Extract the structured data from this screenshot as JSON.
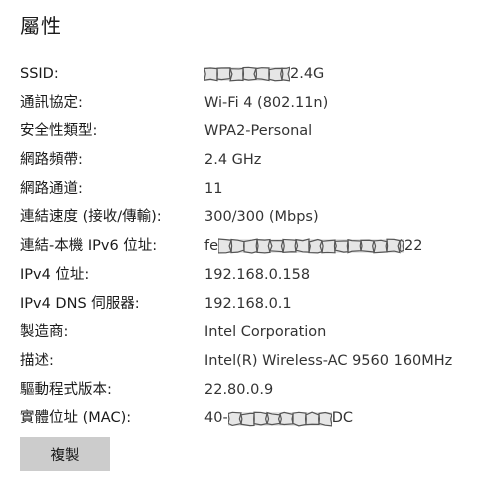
{
  "title": "屬性",
  "properties": [
    {
      "label": "SSID:",
      "value_prefix": "",
      "value_suffix": "2.4G",
      "redacted": true
    },
    {
      "label": "通訊協定:",
      "value": "Wi-Fi 4 (802.11n)"
    },
    {
      "label": "安全性類型:",
      "value": "WPA2-Personal"
    },
    {
      "label": "網路頻帶:",
      "value": "2.4 GHz"
    },
    {
      "label": "網路通道:",
      "value": "11"
    },
    {
      "label": "連結速度 (接收/傳輸):",
      "value": "300/300 (Mbps)"
    },
    {
      "label": "連結-本機 IPv6 位址:",
      "value_prefix": "fe",
      "value_suffix": "22",
      "redacted": true
    },
    {
      "label": "IPv4 位址:",
      "value": "192.168.0.158"
    },
    {
      "label": "IPv4 DNS 伺服器:",
      "value": "192.168.0.1"
    },
    {
      "label": "製造商:",
      "value": "Intel Corporation"
    },
    {
      "label": "描述:",
      "value": "Intel(R) Wireless-AC 9560 160MHz"
    },
    {
      "label": "驅動程式版本:",
      "value": "22.80.0.9"
    },
    {
      "label": "實體位址 (MAC):",
      "value_prefix": "40-",
      "value_suffix": "DC",
      "redacted": true
    }
  ],
  "copy_button_label": "複製",
  "colors": {
    "redaction_fill": "#e6e6e6",
    "redaction_stroke": "#555555",
    "button_bg": "#cccccc"
  }
}
